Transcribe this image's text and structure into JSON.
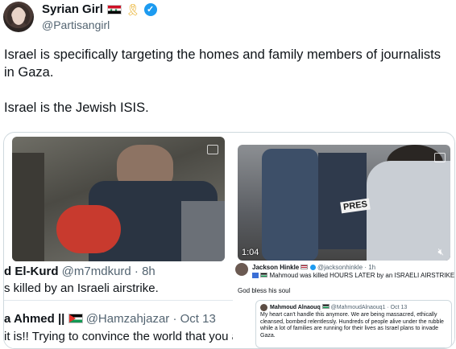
{
  "author": {
    "display_name": "Syrian Girl",
    "handle": "@Partisangirl"
  },
  "tweet": {
    "line1": "Israel is specifically targeting the homes and family members of journalists in Gaza.",
    "line2": "Israel is the Jewish ISIS."
  },
  "left_card": {
    "line1_name": "d El-Kurd",
    "line1_meta": "@m7mdkurd · 8h",
    "line2": "s killed by an Israeli airstrike.",
    "line3_name": "a Ahmed ||",
    "line3_meta": "@Hamzahjazar · Oct 13",
    "line4": "it is!! Trying to convince the world that you ar"
  },
  "right_video": {
    "timestamp": "1:04",
    "press_label": "PRES"
  },
  "right_card": {
    "name": "Jackson Hinkle",
    "meta": "@jacksonhinkle · 1h",
    "subline": "Mahmoud was killed HOURS LATER by an ISRAELI AIRSTRIKE",
    "body": "God bless his soul",
    "quote_name": "Mahmoud Alnaouq",
    "quote_meta": "@MahmoudAlnaouq1 · Oct 13",
    "quote_body": "My heart can't handle this anymore. We are being massacred, ethically cleansed, bombed relentlessly. Hundreds of people alive under the rubble while a lot of families are running for their lives as Israel plans to invade Gaza."
  },
  "colors": {
    "link_blue": "#1d9bf0",
    "text": "#0f1419",
    "muted": "#536471",
    "border": "#cfd9de"
  }
}
